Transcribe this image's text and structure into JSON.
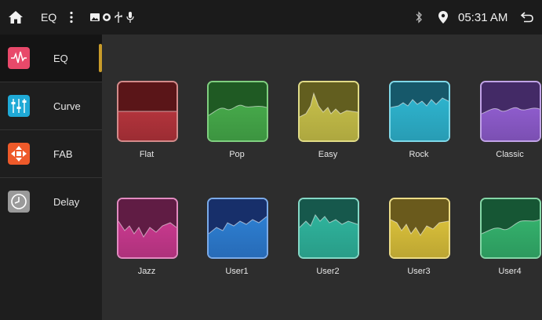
{
  "statusbar": {
    "title": "EQ",
    "time": "05:31 AM",
    "icons": [
      "home-icon",
      "more-vert-icon",
      "picture-icon",
      "navigation-icon",
      "usb-icon",
      "microphone-icon",
      "bluetooth-icon",
      "location-pin-icon",
      "back-icon"
    ]
  },
  "sidebar": {
    "items": [
      {
        "label": "EQ",
        "icon": "eq-wave-icon",
        "color": "#e8496a",
        "active": true
      },
      {
        "label": "Curve",
        "icon": "sliders-icon",
        "color": "#1fa9d6",
        "active": false
      },
      {
        "label": "FAB",
        "icon": "fader-balance-icon",
        "color": "#ee5a2a",
        "active": false
      },
      {
        "label": "Delay",
        "icon": "clock-icon",
        "color": "#9a9a9a",
        "active": false
      }
    ]
  },
  "presets": [
    {
      "label": "Flat",
      "color": "#b2343c",
      "top": "#5a1518",
      "border": "#d38a8a"
    },
    {
      "label": "Pop",
      "color": "#46a84a",
      "top": "#1f5a23",
      "border": "#7fcf7f"
    },
    {
      "label": "Easy",
      "color": "#c7c04a",
      "top": "#625e1f",
      "border": "#e0db86"
    },
    {
      "label": "Rock",
      "color": "#2eb3cd",
      "top": "#16586a",
      "border": "#7ed8e8"
    },
    {
      "label": "Classic",
      "color": "#8e5ccc",
      "top": "#432a66",
      "border": "#c0a2e6"
    },
    {
      "label": "Jazz",
      "color": "#c8398e",
      "top": "#601c44",
      "border": "#e28ac0"
    },
    {
      "label": "User1",
      "color": "#2d7fd1",
      "top": "#172f6a",
      "border": "#7aaae8"
    },
    {
      "label": "User2",
      "color": "#2fb39c",
      "top": "#16584c",
      "border": "#84d8c6"
    },
    {
      "label": "User3",
      "color": "#d8bf3a",
      "top": "#6a5a1c",
      "border": "#ecdc86"
    },
    {
      "label": "User4",
      "color": "#34b06c",
      "top": "#165634",
      "border": "#84d6a6"
    }
  ]
}
